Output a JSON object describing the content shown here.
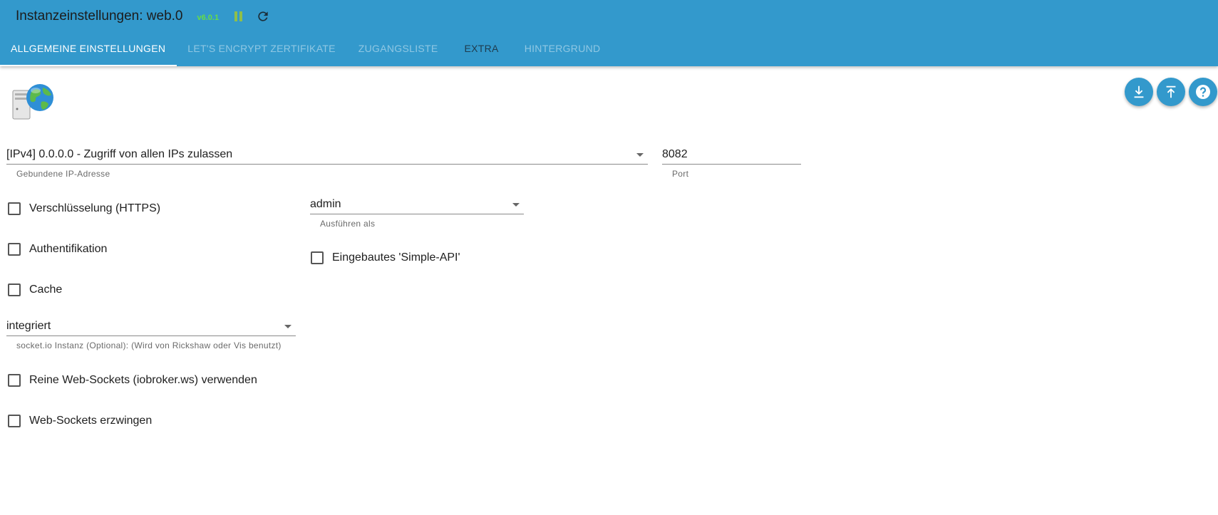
{
  "header": {
    "title": "Instanzeinstellungen: web.0",
    "version": "v6.0.1",
    "pause_icon": "pause-icon",
    "reload_icon": "reload-icon",
    "colors": {
      "bar": "#3399cc",
      "version": "#66dd44",
      "pause": "#8fbf4a"
    }
  },
  "tabs": [
    {
      "label": "ALLGEMEINE EINSTELLUNGEN",
      "active": true
    },
    {
      "label": "LET'S ENCRYPT ZERTIFIKATE",
      "active": false
    },
    {
      "label": "ZUGANGSLISTE",
      "active": false
    },
    {
      "label": "EXTRA",
      "active": false
    },
    {
      "label": "HINTERGRUND",
      "active": false
    }
  ],
  "actions": {
    "download_icon": "download-icon",
    "upload_icon": "upload-icon",
    "help_icon": "help-icon"
  },
  "form": {
    "bind": {
      "value": "[IPv4] 0.0.0.0 - Zugriff von allen IPs zulassen",
      "helper": "Gebundene IP-Adresse"
    },
    "port": {
      "value": "8082",
      "helper": "Port"
    },
    "https": {
      "label": "Verschlüsselung (HTTPS)",
      "checked": false
    },
    "run_as": {
      "value": "admin",
      "helper": "Ausführen als"
    },
    "auth": {
      "label": "Authentifikation",
      "checked": false
    },
    "simple_api": {
      "label": "Eingebautes 'Simple-API'",
      "checked": false
    },
    "cache": {
      "label": "Cache",
      "checked": false
    },
    "socket_io": {
      "value": "integriert",
      "helper": "socket.io Instanz (Optional): (Wird von Rickshaw oder Vis benutzt)"
    },
    "pure_ws": {
      "label": "Reine Web-Sockets (iobroker.ws) verwenden",
      "checked": false
    },
    "force_ws": {
      "label": "Web-Sockets erzwingen",
      "checked": false
    }
  }
}
